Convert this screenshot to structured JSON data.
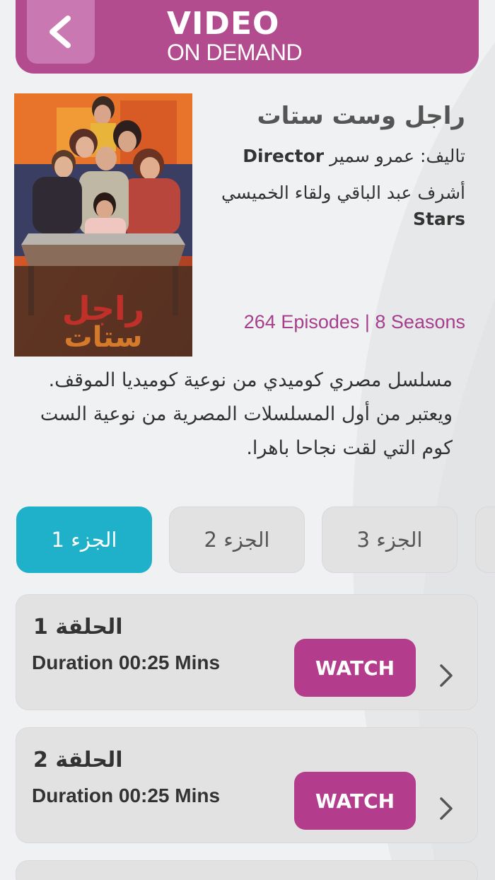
{
  "header": {
    "title_line1": "VIDEO",
    "title_line2": "ON DEMAND",
    "brand_color": "#b34c8f"
  },
  "show": {
    "title": "راجل وست ستات",
    "director_label": "Director",
    "director_text": "تاليف: عمرو سمير",
    "stars_label": "Stars",
    "stars_text": "أشرف عبد الباقي ولقاء الخميسي",
    "episodes_info": "264 Episodes | 8 Seasons",
    "description": "مسلسل مصري كوميدي من نوعية كوميديا الموقف. ويعتبر من أول المسلسلات المصرية من نوعية الست كوم التي لقت نجاحا باهرا."
  },
  "seasons": {
    "active_color": "#1eb1c9",
    "tabs": [
      {
        "label": "الجزء 1",
        "active": true
      },
      {
        "label": "الجزء 2",
        "active": false
      },
      {
        "label": "الجزء 3",
        "active": false
      }
    ]
  },
  "episodes": [
    {
      "title": "الحلقة 1",
      "duration": "Duration 00:25 Mins",
      "action": "WATCH"
    },
    {
      "title": "الحلقة 2",
      "duration": "Duration 00:25 Mins",
      "action": "WATCH"
    }
  ]
}
